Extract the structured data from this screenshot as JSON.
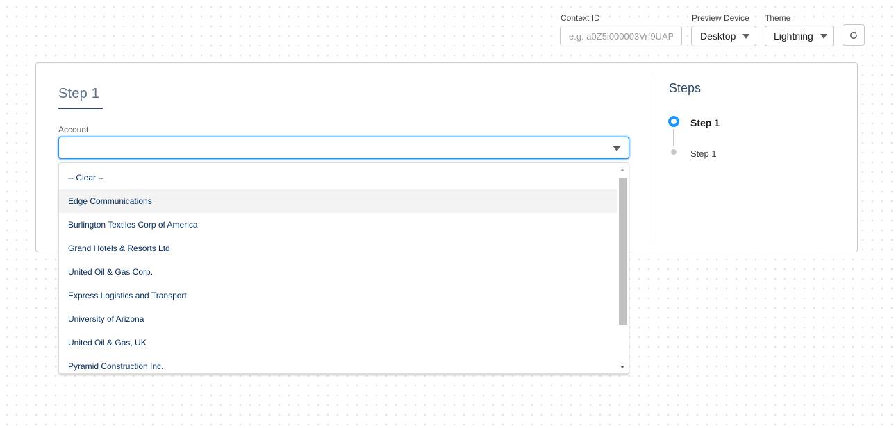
{
  "toolbar": {
    "context_id_label": "Context ID",
    "context_id_placeholder": "e.g. a0Z5i000003Vrf9UAP",
    "context_id_value": "",
    "preview_device_label": "Preview Device",
    "preview_device_value": "Desktop",
    "theme_label": "Theme",
    "theme_value": "Lightning",
    "refresh_icon": "refresh-icon"
  },
  "form": {
    "step_title": "Step 1",
    "account_label": "Account",
    "account_value": "",
    "account_options": [
      "-- Clear --",
      "Edge Communications",
      "Burlington Textiles Corp of America",
      "Grand Hotels & Resorts Ltd",
      "United Oil & Gas Corp.",
      "Express Logistics and Transport",
      "University of Arizona",
      "United Oil & Gas, UK",
      "Pyramid Construction Inc."
    ],
    "highlighted_option": "Edge Communications"
  },
  "steps_panel": {
    "heading": "Steps",
    "items": [
      {
        "label": "Step 1",
        "state": "active"
      },
      {
        "label": "Step 1",
        "state": "inactive"
      }
    ]
  },
  "colors": {
    "accent": "#1b96ff",
    "step_title": "#5a6f8a",
    "option_text": "#032d60",
    "highlight_bg": "#f3f3f3"
  }
}
